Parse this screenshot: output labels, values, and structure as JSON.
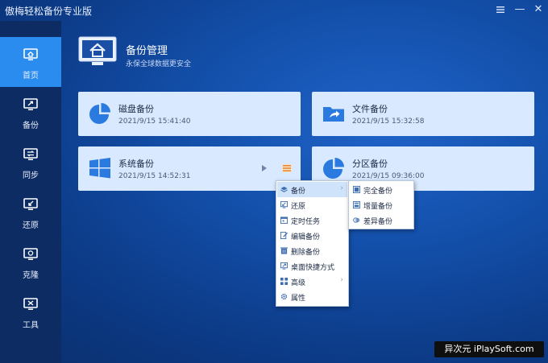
{
  "app": {
    "title": "傲梅轻松备份专业版"
  },
  "window_controls": {
    "menu_icon": "menu-icon",
    "minimize": "—",
    "close": "✕"
  },
  "sidebar": {
    "items": [
      {
        "label": "首页",
        "icon": "home-monitor-icon",
        "active": true
      },
      {
        "label": "备份",
        "icon": "backup-monitor-icon"
      },
      {
        "label": "同步",
        "icon": "sync-monitor-icon"
      },
      {
        "label": "还原",
        "icon": "restore-monitor-icon"
      },
      {
        "label": "克隆",
        "icon": "clone-monitor-icon"
      },
      {
        "label": "工具",
        "icon": "tools-monitor-icon"
      }
    ]
  },
  "header": {
    "title": "备份管理",
    "subtitle": "永保全球数据更安全"
  },
  "cards": [
    {
      "title": "磁盘备份",
      "time": "2021/9/15 15:41:40",
      "icon": "pie-chart-icon"
    },
    {
      "title": "文件备份",
      "time": "2021/9/15 15:32:58",
      "icon": "folder-share-icon"
    },
    {
      "title": "系统备份",
      "time": "2021/9/15 14:52:31",
      "icon": "windows-logo-icon"
    },
    {
      "title": "分区备份",
      "time": "2021/9/15 09:36:00",
      "icon": "pie-chart-icon"
    }
  ],
  "context_menu": {
    "items": [
      {
        "label": "备份",
        "icon": "layers-icon",
        "submenu": true,
        "highlighted": true
      },
      {
        "label": "还原",
        "icon": "restore-icon"
      },
      {
        "label": "定时任务",
        "icon": "schedule-icon"
      },
      {
        "label": "编辑备份",
        "icon": "edit-icon"
      },
      {
        "label": "删除备份",
        "icon": "delete-icon"
      },
      {
        "label": "桌面快捷方式",
        "icon": "shortcut-icon"
      },
      {
        "label": "高级",
        "icon": "grid-icon",
        "submenu": true
      },
      {
        "label": "属性",
        "icon": "gear-icon"
      }
    ]
  },
  "submenu": {
    "items": [
      {
        "label": "完全备份",
        "icon": "full-backup-icon"
      },
      {
        "label": "增量备份",
        "icon": "incremental-backup-icon"
      },
      {
        "label": "差异备份",
        "icon": "differential-backup-icon"
      }
    ]
  },
  "watermark": "异次元 iPlaySoft.com",
  "colors": {
    "accent": "#2b8cf0",
    "sidebar": "#0d2c63",
    "card": "#d9e9ff",
    "menu_highlight": "#cfe3fb"
  }
}
